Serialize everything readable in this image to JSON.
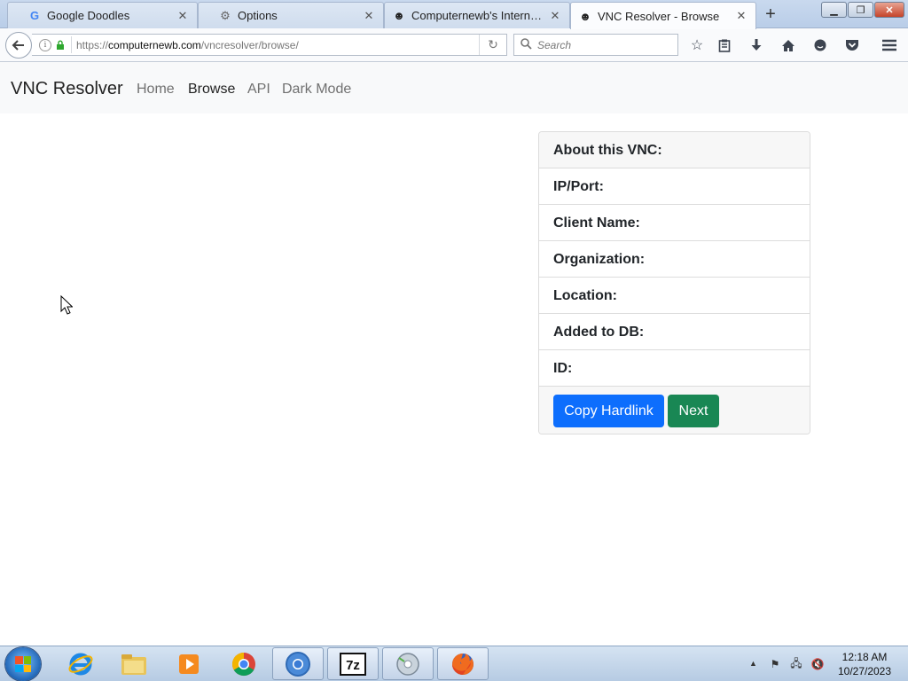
{
  "browser": {
    "tabs": [
      {
        "label": "Google Doodles",
        "icon": "google-icon",
        "active": false
      },
      {
        "label": "Options",
        "icon": "gear-icon",
        "active": false
      },
      {
        "label": "Computernewb's Internet ...",
        "icon": "computernewb-icon",
        "active": false
      },
      {
        "label": "VNC Resolver - Browse",
        "icon": "computernewb-icon",
        "active": true
      }
    ],
    "url_prefix": "https://",
    "url_domain": "computernewb.com",
    "url_path": "/vncresolver/browse/",
    "search_placeholder": "Search"
  },
  "site": {
    "brand": "VNC Resolver",
    "nav": [
      {
        "label": "Home",
        "active": false
      },
      {
        "label": "Browse",
        "active": true
      },
      {
        "label": "API",
        "active": false
      },
      {
        "label": "Dark Mode",
        "active": false
      }
    ]
  },
  "card": {
    "header": "About this VNC:",
    "rows": [
      "IP/Port:",
      "Client Name:",
      "Organization:",
      "Location:",
      "Added to DB:",
      "ID:"
    ],
    "copy_button": "Copy Hardlink",
    "next_button": "Next",
    "colors": {
      "copy": "#0d6efd",
      "next": "#198754"
    }
  },
  "taskbar": {
    "apps": [
      "internet-explorer-icon",
      "file-explorer-icon",
      "media-player-icon",
      "chrome-icon",
      "chromium-icon",
      "7zip-icon",
      "media-center-icon",
      "firefox-icon"
    ],
    "time": "12:18 AM",
    "date": "10/27/2023"
  }
}
